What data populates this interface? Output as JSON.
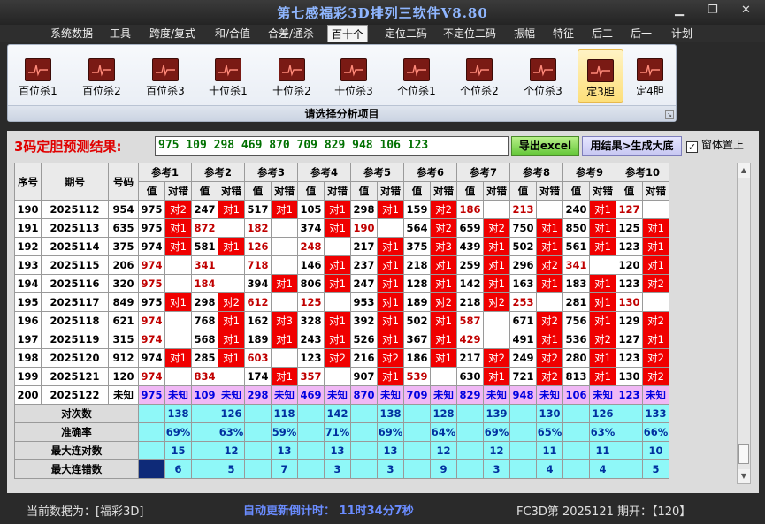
{
  "window": {
    "title": "第七感福彩3D排列三软件V8.80"
  },
  "menu": [
    "系统数据",
    "工具",
    "跨度/复式",
    "和/合值",
    "合差/通杀",
    "百十个",
    "定位二码",
    "不定位二码",
    "振幅",
    "特征",
    "后二",
    "后一",
    "计划"
  ],
  "menu_active": "百十个",
  "ribbon": {
    "tools": [
      "百位杀1",
      "百位杀2",
      "百位杀3",
      "十位杀1",
      "十位杀2",
      "十位杀3",
      "个位杀1",
      "个位杀2",
      "个位杀3",
      "定3胆",
      "定4胆"
    ],
    "active": "定3胆",
    "group_label": "请选择分析项目"
  },
  "prediction": {
    "label": "3码定胆预测结果:",
    "values": "975 109 298 469 870 709 829 948 106 123",
    "export_button": "导出excel",
    "generate_button": "用结果>生成大底",
    "topmost_label": "窗体置上",
    "topmost_checked": "✓"
  },
  "table": {
    "headers": {
      "seq": "序号",
      "period": "期号",
      "code": "号码",
      "value": "值",
      "result": "对错"
    },
    "refs": [
      "参考1",
      "参考2",
      "参考3",
      "参考4",
      "参考5",
      "参考6",
      "参考7",
      "参考8",
      "参考9",
      "参考10"
    ],
    "rows": [
      {
        "seq": "190",
        "period": "2025112",
        "code": "954",
        "cells": [
          [
            "975",
            "对2"
          ],
          [
            "247",
            "对1"
          ],
          [
            "517",
            "对1"
          ],
          [
            "105",
            "对1"
          ],
          [
            "298",
            "对1"
          ],
          [
            "159",
            "对2"
          ],
          [
            "186",
            ""
          ],
          [
            "213",
            ""
          ],
          [
            "240",
            "对1"
          ],
          [
            "127",
            ""
          ]
        ]
      },
      {
        "seq": "191",
        "period": "2025113",
        "code": "635",
        "cells": [
          [
            "975",
            "对1"
          ],
          [
            "872",
            ""
          ],
          [
            "182",
            ""
          ],
          [
            "374",
            "对1"
          ],
          [
            "190",
            ""
          ],
          [
            "564",
            "对2"
          ],
          [
            "659",
            "对2"
          ],
          [
            "750",
            "对1"
          ],
          [
            "850",
            "对1"
          ],
          [
            "125",
            "对1"
          ]
        ]
      },
      {
        "seq": "192",
        "period": "2025114",
        "code": "375",
        "cells": [
          [
            "974",
            "对1"
          ],
          [
            "581",
            "对1"
          ],
          [
            "126",
            ""
          ],
          [
            "248",
            ""
          ],
          [
            "217",
            "对1"
          ],
          [
            "375",
            "对3"
          ],
          [
            "439",
            "对1"
          ],
          [
            "502",
            "对1"
          ],
          [
            "561",
            "对1"
          ],
          [
            "123",
            "对1"
          ]
        ]
      },
      {
        "seq": "193",
        "period": "2025115",
        "code": "206",
        "cells": [
          [
            "974",
            ""
          ],
          [
            "341",
            ""
          ],
          [
            "718",
            ""
          ],
          [
            "146",
            "对1"
          ],
          [
            "237",
            "对1"
          ],
          [
            "218",
            "对1"
          ],
          [
            "259",
            "对1"
          ],
          [
            "296",
            "对2"
          ],
          [
            "341",
            ""
          ],
          [
            "120",
            "对1"
          ]
        ]
      },
      {
        "seq": "194",
        "period": "2025116",
        "code": "320",
        "cells": [
          [
            "975",
            ""
          ],
          [
            "184",
            ""
          ],
          [
            "394",
            "对1"
          ],
          [
            "806",
            "对1"
          ],
          [
            "247",
            "对1"
          ],
          [
            "128",
            "对1"
          ],
          [
            "142",
            "对1"
          ],
          [
            "163",
            "对1"
          ],
          [
            "183",
            "对1"
          ],
          [
            "123",
            "对2"
          ]
        ]
      },
      {
        "seq": "195",
        "period": "2025117",
        "code": "849",
        "cells": [
          [
            "975",
            "对1"
          ],
          [
            "298",
            "对2"
          ],
          [
            "612",
            ""
          ],
          [
            "125",
            ""
          ],
          [
            "953",
            "对1"
          ],
          [
            "189",
            "对2"
          ],
          [
            "218",
            "对2"
          ],
          [
            "253",
            ""
          ],
          [
            "281",
            "对1"
          ],
          [
            "130",
            ""
          ]
        ]
      },
      {
        "seq": "196",
        "period": "2025118",
        "code": "621",
        "cells": [
          [
            "974",
            ""
          ],
          [
            "768",
            "对1"
          ],
          [
            "162",
            "对3"
          ],
          [
            "328",
            "对1"
          ],
          [
            "392",
            "对1"
          ],
          [
            "502",
            "对1"
          ],
          [
            "587",
            ""
          ],
          [
            "671",
            "对2"
          ],
          [
            "756",
            "对1"
          ],
          [
            "129",
            "对2"
          ]
        ]
      },
      {
        "seq": "197",
        "period": "2025119",
        "code": "315",
        "cells": [
          [
            "974",
            ""
          ],
          [
            "568",
            "对1"
          ],
          [
            "189",
            "对1"
          ],
          [
            "243",
            "对1"
          ],
          [
            "526",
            "对1"
          ],
          [
            "367",
            "对1"
          ],
          [
            "429",
            ""
          ],
          [
            "491",
            "对1"
          ],
          [
            "536",
            "对2"
          ],
          [
            "127",
            "对1"
          ]
        ]
      },
      {
        "seq": "198",
        "period": "2025120",
        "code": "912",
        "cells": [
          [
            "974",
            "对1"
          ],
          [
            "285",
            "对1"
          ],
          [
            "603",
            ""
          ],
          [
            "123",
            "对2"
          ],
          [
            "216",
            "对2"
          ],
          [
            "186",
            "对1"
          ],
          [
            "217",
            "对2"
          ],
          [
            "249",
            "对2"
          ],
          [
            "280",
            "对1"
          ],
          [
            "123",
            "对2"
          ]
        ]
      },
      {
        "seq": "199",
        "period": "2025121",
        "code": "120",
        "cells": [
          [
            "974",
            ""
          ],
          [
            "834",
            ""
          ],
          [
            "174",
            "对1"
          ],
          [
            "357",
            ""
          ],
          [
            "907",
            "对1"
          ],
          [
            "539",
            ""
          ],
          [
            "630",
            "对1"
          ],
          [
            "721",
            "对2"
          ],
          [
            "813",
            "对1"
          ],
          [
            "130",
            "对2"
          ]
        ]
      }
    ],
    "last": {
      "seq": "200",
      "period": "2025122",
      "code": "未知",
      "values": [
        "975",
        "109",
        "298",
        "469",
        "870",
        "709",
        "829",
        "948",
        "106",
        "123"
      ],
      "unknown": "未知"
    },
    "stats": [
      {
        "label": "对次数",
        "values": [
          "138",
          "126",
          "118",
          "142",
          "138",
          "128",
          "139",
          "130",
          "126",
          "133"
        ]
      },
      {
        "label": "准确率",
        "values": [
          "69%",
          "63%",
          "59%",
          "71%",
          "69%",
          "64%",
          "69%",
          "65%",
          "63%",
          "66%"
        ]
      },
      {
        "label": "最大连对数",
        "values": [
          "15",
          "12",
          "13",
          "13",
          "13",
          "12",
          "12",
          "11",
          "11",
          "10"
        ]
      },
      {
        "label": "最大连错数",
        "values": [
          "6",
          "5",
          "7",
          "3",
          "3",
          "9",
          "3",
          "4",
          "4",
          "5"
        ]
      }
    ]
  },
  "status": {
    "left": "当前数据为：[福彩3D]",
    "countdown": "自动更新倒计时：  11时34分7秒",
    "right": "FC3D第 2025121 期开：【120】"
  },
  "colors": {
    "hit": "#f00000",
    "stat_bg": "#8ff8f8",
    "last_row": "#f0b8f5",
    "accent_text": "#6a8cff"
  }
}
